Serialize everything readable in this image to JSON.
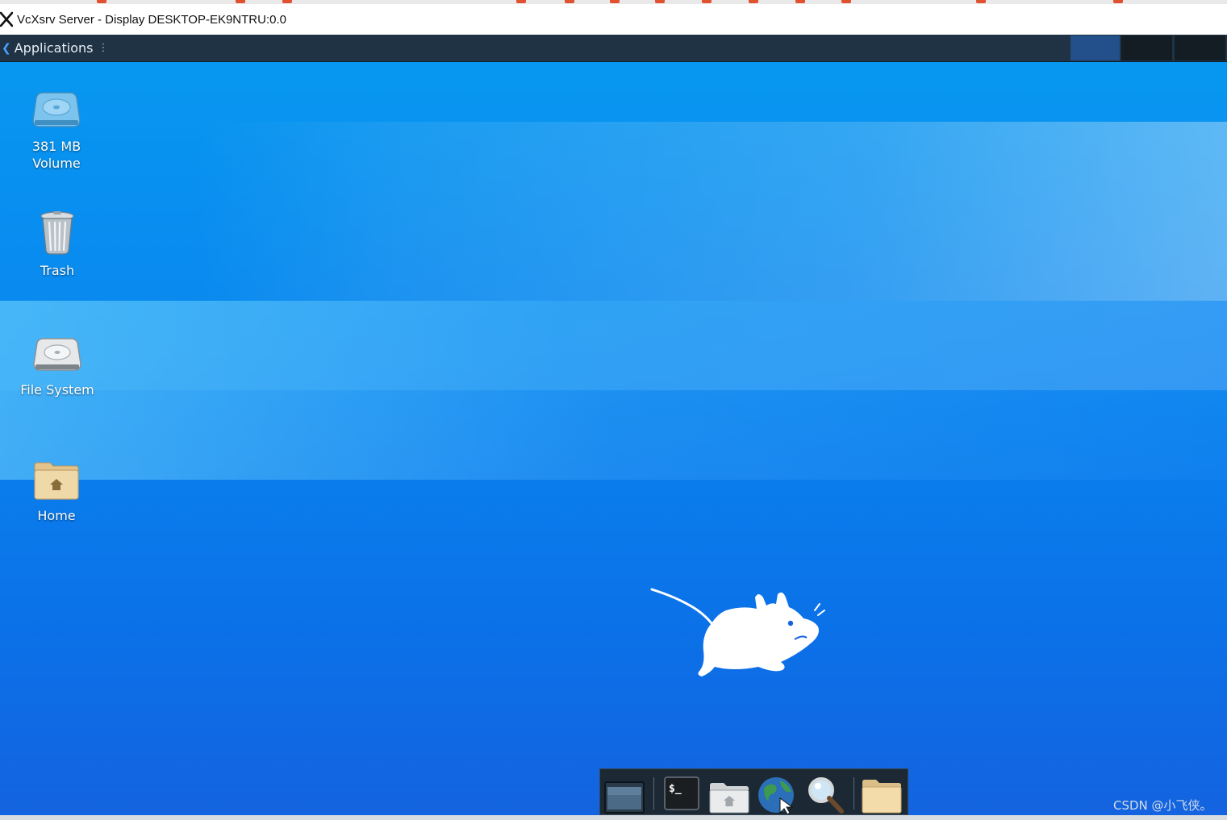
{
  "window": {
    "title": "VcXsrv Server - Display DESKTOP-EK9NTRU:0.0"
  },
  "panel": {
    "applications_label": "Applications",
    "applications_icon": "xfce-mouse-icon",
    "menu_icon": "menu-dots-icon"
  },
  "desktop": {
    "icons": [
      {
        "label": "381 MB\nVolume",
        "icon": "drive-icon"
      },
      {
        "label": "Trash",
        "icon": "trash-icon"
      },
      {
        "label": "File System",
        "icon": "harddisk-icon"
      },
      {
        "label": "Home",
        "icon": "home-folder-icon"
      }
    ],
    "wallpaper_mascot": "xfce-mouse-mascot"
  },
  "dock": {
    "items": [
      {
        "icon": "show-desktop-icon"
      },
      {
        "icon": "terminal-icon"
      },
      {
        "icon": "file-manager-icon"
      },
      {
        "icon": "web-browser-icon"
      },
      {
        "icon": "app-finder-icon"
      },
      {
        "icon": "folder-icon"
      }
    ]
  },
  "watermark": "CSDN @小飞侠。",
  "colors": {
    "panel": "#1f3345",
    "desktop_top": "#0797f0",
    "desktop_bottom": "#1463e0",
    "dock": "#1c2935",
    "workspace_active": "#23508a"
  }
}
